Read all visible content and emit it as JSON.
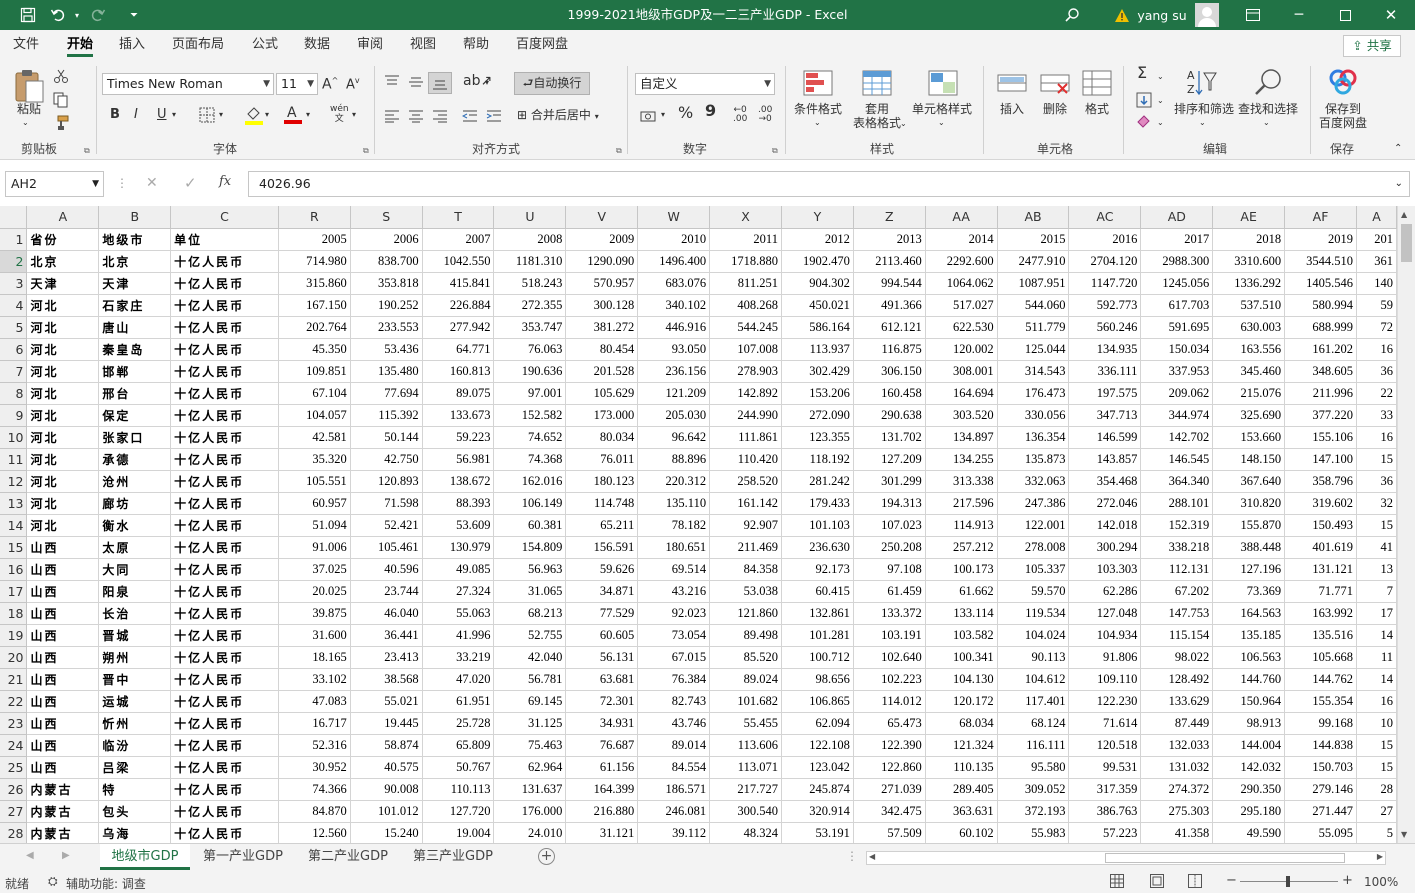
{
  "app": {
    "title": "1999-2021地级市GDP及一二三产业GDP  -  Excel",
    "user": "yang su"
  },
  "menu": [
    "文件",
    "开始",
    "插入",
    "页面布局",
    "公式",
    "数据",
    "审阅",
    "视图",
    "帮助",
    "百度网盘"
  ],
  "share_label": "共享",
  "ribbon": {
    "clipboard": {
      "label": "剪贴板",
      "paste": "粘贴"
    },
    "font": {
      "label": "字体",
      "name": "Times New Roman",
      "size": "11",
      "bold": "B",
      "italic": "I",
      "underline": "U"
    },
    "align": {
      "label": "对齐方式",
      "wrap": "自动换行",
      "merge": "合并后居中"
    },
    "number": {
      "label": "数字",
      "format": "自定义",
      "percent": "%",
      "comma": "9"
    },
    "styles": {
      "label": "样式",
      "cond": "条件格式",
      "table": "套用\n表格格式",
      "cell": "单元格样式"
    },
    "cells": {
      "label": "单元格",
      "insert": "插入",
      "delete": "删除",
      "format": "格式"
    },
    "editing": {
      "label": "编辑",
      "sort": "排序和筛选",
      "find": "查找和选择"
    },
    "save": {
      "label": "保存",
      "baidu": "保存到\n百度网盘"
    }
  },
  "formula_bar": {
    "cell": "AH2",
    "value": "4026.96",
    "fx": "fx"
  },
  "columns": [
    "A",
    "B",
    "C",
    "R",
    "S",
    "T",
    "U",
    "V",
    "W",
    "X",
    "Y",
    "Z",
    "AA",
    "AB",
    "AC",
    "AD",
    "AE",
    "AF",
    "A"
  ],
  "header_row": [
    "省份",
    "地级市",
    "单位",
    "2005",
    "2006",
    "2007",
    "2008",
    "2009",
    "2010",
    "2011",
    "2012",
    "2013",
    "2014",
    "2015",
    "2016",
    "2017",
    "2018",
    "2019",
    "201"
  ],
  "rows": [
    [
      "北京",
      "北京",
      "十亿人民币",
      "714.980",
      "838.700",
      "1042.550",
      "1181.310",
      "1290.090",
      "1496.400",
      "1718.880",
      "1902.470",
      "2113.460",
      "2292.600",
      "2477.910",
      "2704.120",
      "2988.300",
      "3310.600",
      "3544.510",
      "361"
    ],
    [
      "天津",
      "天津",
      "十亿人民币",
      "315.860",
      "353.818",
      "415.841",
      "518.243",
      "570.957",
      "683.076",
      "811.251",
      "904.302",
      "994.544",
      "1064.062",
      "1087.951",
      "1147.720",
      "1245.056",
      "1336.292",
      "1405.546",
      "140"
    ],
    [
      "河北",
      "石家庄",
      "十亿人民币",
      "167.150",
      "190.252",
      "226.884",
      "272.355",
      "300.128",
      "340.102",
      "408.268",
      "450.021",
      "491.366",
      "517.027",
      "544.060",
      "592.773",
      "617.703",
      "537.510",
      "580.994",
      "59"
    ],
    [
      "河北",
      "唐山",
      "十亿人民币",
      "202.764",
      "233.553",
      "277.942",
      "353.747",
      "381.272",
      "446.916",
      "544.245",
      "586.164",
      "612.121",
      "622.530",
      "511.779",
      "560.246",
      "591.695",
      "630.003",
      "688.999",
      "72"
    ],
    [
      "河北",
      "秦皇岛",
      "十亿人民币",
      "45.350",
      "53.436",
      "64.771",
      "76.063",
      "80.454",
      "93.050",
      "107.008",
      "113.937",
      "116.875",
      "120.002",
      "125.044",
      "134.935",
      "150.034",
      "163.556",
      "161.202",
      "16"
    ],
    [
      "河北",
      "邯郸",
      "十亿人民币",
      "109.851",
      "135.480",
      "160.813",
      "190.636",
      "201.528",
      "236.156",
      "278.903",
      "302.429",
      "306.150",
      "308.001",
      "314.543",
      "336.111",
      "337.953",
      "345.460",
      "348.605",
      "36"
    ],
    [
      "河北",
      "邢台",
      "十亿人民币",
      "67.104",
      "77.694",
      "89.075",
      "97.001",
      "105.629",
      "121.209",
      "142.892",
      "153.206",
      "160.458",
      "164.694",
      "176.473",
      "197.575",
      "209.062",
      "215.076",
      "211.996",
      "22"
    ],
    [
      "河北",
      "保定",
      "十亿人民币",
      "104.057",
      "115.392",
      "133.673",
      "152.582",
      "173.000",
      "205.030",
      "244.990",
      "272.090",
      "290.638",
      "303.520",
      "330.056",
      "347.713",
      "344.974",
      "325.690",
      "377.220",
      "33"
    ],
    [
      "河北",
      "张家口",
      "十亿人民币",
      "42.581",
      "50.144",
      "59.223",
      "74.652",
      "80.034",
      "96.642",
      "111.861",
      "123.355",
      "131.702",
      "134.897",
      "136.354",
      "146.599",
      "142.702",
      "153.660",
      "155.106",
      "16"
    ],
    [
      "河北",
      "承德",
      "十亿人民币",
      "35.320",
      "42.750",
      "56.981",
      "74.368",
      "76.011",
      "88.896",
      "110.420",
      "118.192",
      "127.209",
      "134.255",
      "135.873",
      "143.857",
      "146.545",
      "148.150",
      "147.100",
      "15"
    ],
    [
      "河北",
      "沧州",
      "十亿人民币",
      "105.551",
      "120.893",
      "138.672",
      "162.016",
      "180.123",
      "220.312",
      "258.520",
      "281.242",
      "301.299",
      "313.338",
      "332.063",
      "354.468",
      "364.340",
      "367.640",
      "358.796",
      "36"
    ],
    [
      "河北",
      "廊坊",
      "十亿人民币",
      "60.957",
      "71.598",
      "88.393",
      "106.149",
      "114.748",
      "135.110",
      "161.142",
      "179.433",
      "194.313",
      "217.596",
      "247.386",
      "272.046",
      "288.101",
      "310.820",
      "319.602",
      "32"
    ],
    [
      "河北",
      "衡水",
      "十亿人民币",
      "51.094",
      "52.421",
      "53.609",
      "60.381",
      "65.211",
      "78.182",
      "92.907",
      "101.103",
      "107.023",
      "114.913",
      "122.001",
      "142.018",
      "152.319",
      "155.870",
      "150.493",
      "15"
    ],
    [
      "山西",
      "太原",
      "十亿人民币",
      "91.006",
      "105.461",
      "130.979",
      "154.809",
      "156.591",
      "180.651",
      "211.469",
      "236.630",
      "250.208",
      "257.212",
      "278.008",
      "300.294",
      "338.218",
      "388.448",
      "401.619",
      "41"
    ],
    [
      "山西",
      "大同",
      "十亿人民币",
      "37.025",
      "40.596",
      "49.085",
      "56.963",
      "59.626",
      "69.514",
      "84.358",
      "92.173",
      "97.108",
      "100.173",
      "105.337",
      "103.303",
      "112.131",
      "127.196",
      "131.121",
      "13"
    ],
    [
      "山西",
      "阳泉",
      "十亿人民币",
      "20.025",
      "23.744",
      "27.324",
      "31.065",
      "34.871",
      "43.216",
      "53.038",
      "60.415",
      "61.459",
      "61.662",
      "59.570",
      "62.286",
      "67.202",
      "73.369",
      "71.771",
      "7"
    ],
    [
      "山西",
      "长治",
      "十亿人民币",
      "39.875",
      "46.040",
      "55.063",
      "68.213",
      "77.529",
      "92.023",
      "121.860",
      "132.861",
      "133.372",
      "133.114",
      "119.534",
      "127.048",
      "147.753",
      "164.563",
      "163.992",
      "17"
    ],
    [
      "山西",
      "晋城",
      "十亿人民币",
      "31.600",
      "36.441",
      "41.996",
      "52.755",
      "60.605",
      "73.054",
      "89.498",
      "101.281",
      "103.191",
      "103.582",
      "104.024",
      "104.934",
      "115.154",
      "135.185",
      "135.516",
      "14"
    ],
    [
      "山西",
      "朔州",
      "十亿人民币",
      "18.165",
      "23.413",
      "33.219",
      "42.040",
      "56.131",
      "67.015",
      "85.520",
      "100.712",
      "102.640",
      "100.341",
      "90.113",
      "91.806",
      "98.022",
      "106.563",
      "105.668",
      "11"
    ],
    [
      "山西",
      "晋中",
      "十亿人民币",
      "33.102",
      "38.568",
      "47.020",
      "56.781",
      "63.681",
      "76.384",
      "89.024",
      "98.656",
      "102.223",
      "104.130",
      "104.612",
      "109.110",
      "128.492",
      "144.760",
      "144.762",
      "14"
    ],
    [
      "山西",
      "运城",
      "十亿人民币",
      "47.083",
      "55.021",
      "61.951",
      "69.145",
      "72.301",
      "82.743",
      "101.682",
      "106.865",
      "114.012",
      "120.172",
      "117.401",
      "122.230",
      "133.629",
      "150.964",
      "155.354",
      "16"
    ],
    [
      "山西",
      "忻州",
      "十亿人民币",
      "16.717",
      "19.445",
      "25.728",
      "31.125",
      "34.931",
      "43.746",
      "55.455",
      "62.094",
      "65.473",
      "68.034",
      "68.124",
      "71.614",
      "87.449",
      "98.913",
      "99.168",
      "10"
    ],
    [
      "山西",
      "临汾",
      "十亿人民币",
      "52.316",
      "58.874",
      "65.809",
      "75.463",
      "76.687",
      "89.014",
      "113.606",
      "122.108",
      "122.390",
      "121.324",
      "116.111",
      "120.518",
      "132.033",
      "144.004",
      "144.838",
      "15"
    ],
    [
      "山西",
      "吕梁",
      "十亿人民币",
      "30.952",
      "40.575",
      "50.767",
      "62.964",
      "61.156",
      "84.554",
      "113.071",
      "123.042",
      "122.860",
      "110.135",
      "95.580",
      "99.531",
      "131.032",
      "142.032",
      "150.703",
      "15"
    ],
    [
      "内蒙古",
      "特",
      "十亿人民币",
      "74.366",
      "90.008",
      "110.113",
      "131.637",
      "164.399",
      "186.571",
      "217.727",
      "245.874",
      "271.039",
      "289.405",
      "309.052",
      "317.359",
      "274.372",
      "290.350",
      "279.146",
      "28"
    ],
    [
      "内蒙古",
      "包头",
      "十亿人民币",
      "84.870",
      "101.012",
      "127.720",
      "176.000",
      "216.880",
      "246.081",
      "300.540",
      "320.914",
      "342.475",
      "363.631",
      "372.193",
      "386.763",
      "275.303",
      "295.180",
      "271.447",
      "27"
    ],
    [
      "内蒙古",
      "乌海",
      "十亿人民币",
      "12.560",
      "15.240",
      "19.004",
      "24.010",
      "31.121",
      "39.112",
      "48.324",
      "53.191",
      "57.509",
      "60.102",
      "55.983",
      "57.223",
      "41.358",
      "49.590",
      "55.095",
      "5"
    ]
  ],
  "sheets": [
    "地级市GDP",
    "第一产业GDP",
    "第二产业GDP",
    "第三产业GDP"
  ],
  "status": {
    "ready": "就绪",
    "accessibility": "辅助功能: 调查",
    "zoom": "100%"
  }
}
